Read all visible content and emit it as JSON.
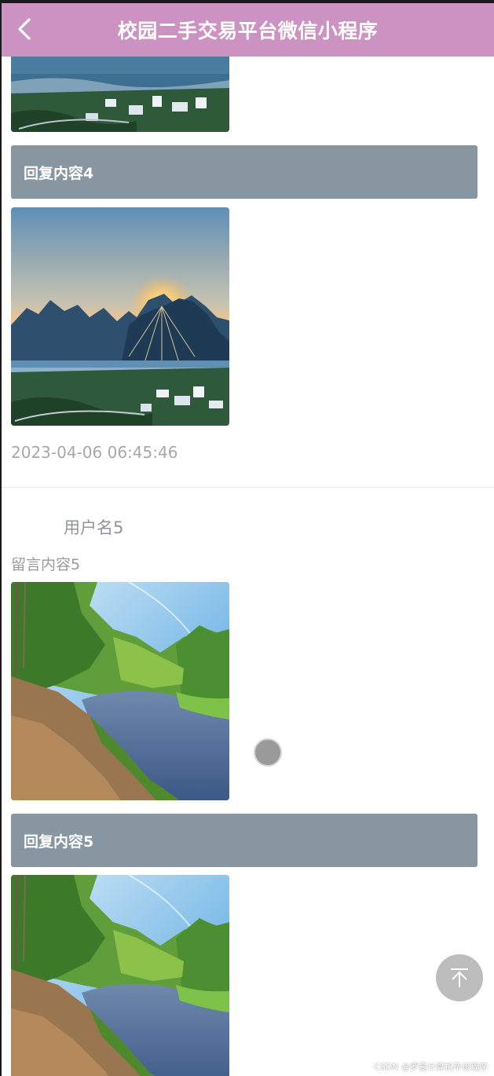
{
  "header": {
    "title": "校园二手交易平台微信小程序",
    "back_icon": "chevron-left-icon",
    "background_color": "#cc93c2"
  },
  "entries": [
    {
      "reply_label": "回复内容4",
      "time": "2023-04-06 06:45:46",
      "images": [
        "karst-sunset-landscape",
        "karst-sunset-landscape"
      ]
    },
    {
      "username": "用户名5",
      "message": "留言内容5",
      "reply_label": "回复内容5",
      "images": [
        "forest-river-landscape",
        "forest-river-landscape"
      ]
    }
  ],
  "floating": {
    "back_to_top_icon": "arrow-up-icon",
    "drag_dot_color": "#9a9a9a"
  },
  "watermark": "CSDN @罗曼计算机毕设程序"
}
